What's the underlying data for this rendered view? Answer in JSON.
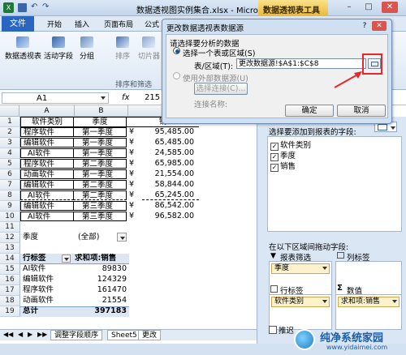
{
  "app": {
    "title": "数据透视图实例集合.xlsx - Microsoft Excel",
    "context_tab": "数据透视表工具",
    "win_min": "–",
    "win_max": "□",
    "win_close": "✕"
  },
  "ribbon": {
    "file_tab": "文件",
    "tabs": [
      "开始",
      "插入",
      "页面布局",
      "公式"
    ],
    "buttons": [
      {
        "label": "数据透视表"
      },
      {
        "label": "活动字段"
      },
      {
        "label": "分组"
      },
      {
        "label": "排序"
      },
      {
        "label": "切片器"
      }
    ],
    "group_label": "排序和筛选"
  },
  "formula_bar": {
    "name_box": "A1",
    "formula_fragment": "215"
  },
  "sheet": {
    "col_headers": [
      "A",
      "B",
      "C"
    ],
    "row_numbers": [
      "1",
      "2",
      "3",
      "4",
      "5",
      "6",
      "7",
      "8",
      "9",
      "10",
      "11",
      "12",
      "13",
      "14",
      "15",
      "16",
      "17",
      "18",
      "19"
    ],
    "table_header": [
      "软件类别",
      "季度",
      "销"
    ],
    "table_rows": [
      [
        "程序软件",
        "第一季度",
        "¥",
        "95,485.00"
      ],
      [
        "编辑软件",
        "第一季度",
        "¥",
        "65,485.00"
      ],
      [
        "AI软件",
        "第一季度",
        "¥",
        "24,585.00"
      ],
      [
        "程序软件",
        "第二季度",
        "¥",
        "65,985.00"
      ],
      [
        "动画软件",
        "第一季度",
        "¥",
        "21,554.00"
      ],
      [
        "编辑软件",
        "第二季度",
        "¥",
        "58,844.00"
      ],
      [
        "AI软件",
        "第二季度",
        "¥",
        "65,245.00"
      ],
      [
        "编辑软件",
        "第三季度",
        "¥",
        "86,542.00"
      ],
      [
        "AI软件",
        "第三季度",
        "¥",
        "96,582.00"
      ]
    ],
    "filter_label": "季度",
    "filter_value": "(全部)",
    "pivot_header": [
      "行标签",
      "求和项:销售"
    ],
    "pivot_rows": [
      [
        "AI软件",
        "89830"
      ],
      [
        "编辑软件",
        "124329"
      ],
      [
        "程序软件",
        "161470"
      ],
      [
        "动画软件",
        "21554"
      ]
    ],
    "pivot_total": [
      "总计",
      "397183"
    ]
  },
  "sheet_tabs": [
    "调整字段顺序",
    "Sheet5",
    "更改"
  ],
  "dialog": {
    "title": "更改数据透视表数据源",
    "help": "?",
    "close": "✕",
    "prompt": "请选择要分析的数据",
    "option1": "选择一个表或区域(S)",
    "range_label": "表/区域(T):",
    "range_value": "更改数据源!$A$1:$C$8",
    "option2": "使用外部数据源(U)",
    "choose_conn": "选择连接(C)...",
    "conn_name_label": "连接名称:",
    "ok": "确定",
    "cancel": "取消"
  },
  "pivot_pane": {
    "choose_fields": "选择要添加到报表的字段:",
    "fields": [
      {
        "label": "软件类别",
        "checked": true
      },
      {
        "label": "季度",
        "checked": true
      },
      {
        "label": "销售",
        "checked": true
      }
    ],
    "drag_label": "在以下区域间拖动字段:",
    "report_filter": "报表筛选",
    "column_labels": "列标签",
    "row_labels": "行标签",
    "values": "数值",
    "filter_pill": "季度",
    "row_pill": "软件类别",
    "value_pill": "求和项:销售",
    "defer": "推迟"
  },
  "watermark": {
    "text": "纯净系统家园",
    "url": "www.yidaimei.com"
  }
}
